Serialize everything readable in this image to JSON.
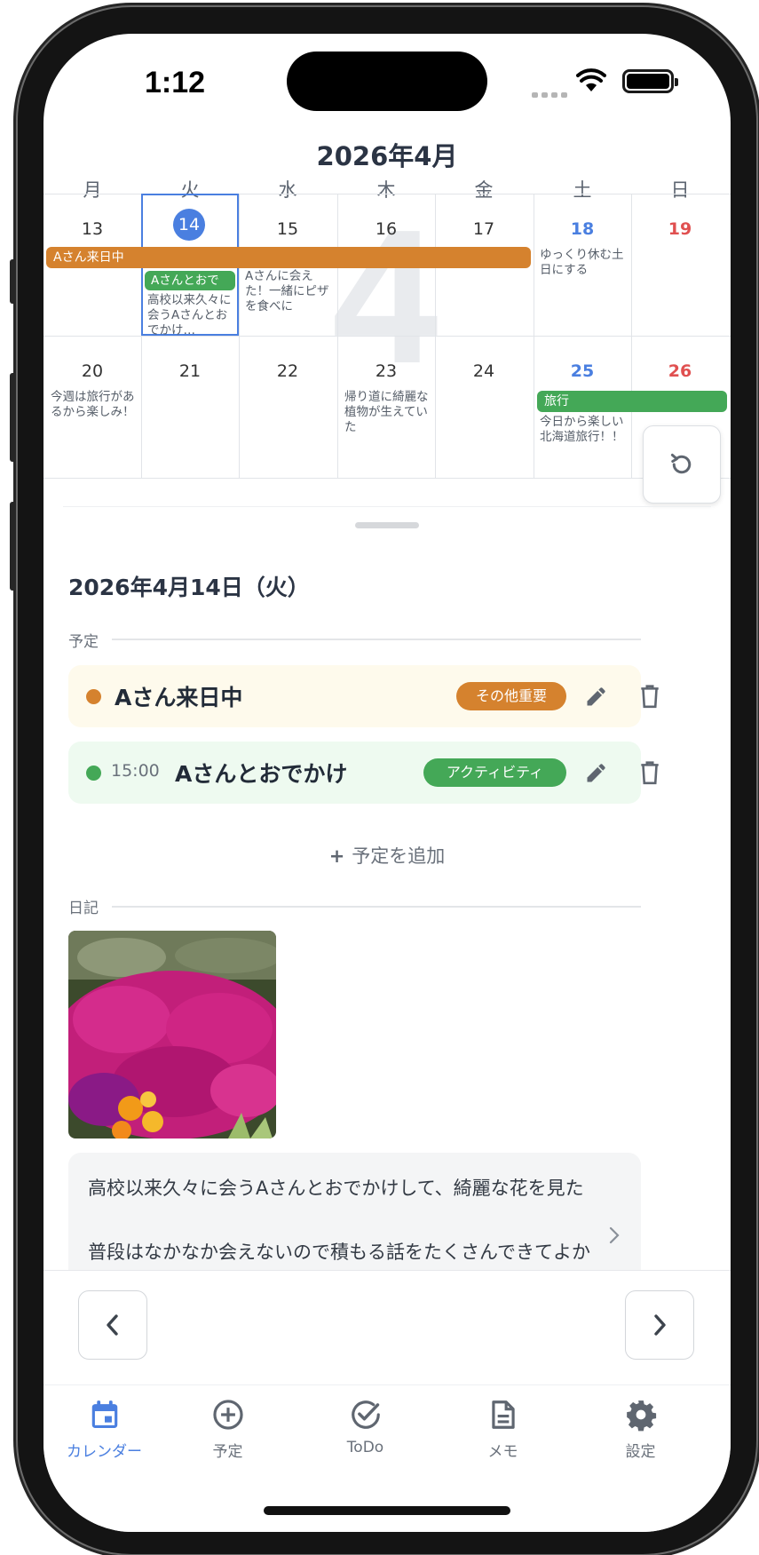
{
  "status_bar": {
    "time": "1:12"
  },
  "calendar": {
    "month_title": "2026年4月",
    "month_watermark": "4",
    "weekdays": [
      "月",
      "火",
      "水",
      "木",
      "金",
      "土",
      "日"
    ],
    "week1": {
      "days": [
        "13",
        "14",
        "15",
        "16",
        "17",
        "18",
        "19"
      ],
      "bar_event": "Aさん来日中",
      "tue_event": "Aさんとおで",
      "tue_note": "高校以来久々に会うAさんとおでかけ…",
      "wed_note": "Aさんに会えた！一緒にピザを食べに",
      "sat_note": "ゆっくり休む土日にする"
    },
    "week2": {
      "days": [
        "20",
        "21",
        "22",
        "23",
        "24",
        "25",
        "26"
      ],
      "mon_note": "今週は旅行があるから楽しみ！",
      "thu_note": "帰り道に綺麗な植物が生えていた",
      "bar_event": "旅行",
      "sat_note": "今日から楽しい北海道旅行！！"
    },
    "colors": {
      "accent": "#4a7fe0",
      "orange": "#d5822e",
      "green": "#44a857",
      "sunday": "#e05050"
    }
  },
  "detail": {
    "date_title": "2026年4月14日（火）",
    "schedule_label": "予定",
    "events": [
      {
        "title": "Aさん来日中",
        "time": "",
        "tag": "その他重要",
        "color": "#d5822e",
        "bg": "#fefaec"
      },
      {
        "title": "Aさんとおでかけ",
        "time": "15:00",
        "tag": "アクティビティ",
        "color": "#44a857",
        "bg": "#eefaf0"
      }
    ],
    "add_label": "予定を追加",
    "diary_label": "日記",
    "diary_lines": [
      "高校以来久々に会うAさんとおでかけして、綺麗な花を見た",
      "普段はなかなか会えないので積もる話をたくさんできてよか"
    ]
  },
  "tabs": [
    {
      "label": "カレンダー",
      "icon": "calendar-icon"
    },
    {
      "label": "予定",
      "icon": "plus-circle-icon"
    },
    {
      "label": "ToDo",
      "icon": "check-circle-icon"
    },
    {
      "label": "メモ",
      "icon": "document-icon"
    },
    {
      "label": "設定",
      "icon": "gear-icon"
    }
  ]
}
